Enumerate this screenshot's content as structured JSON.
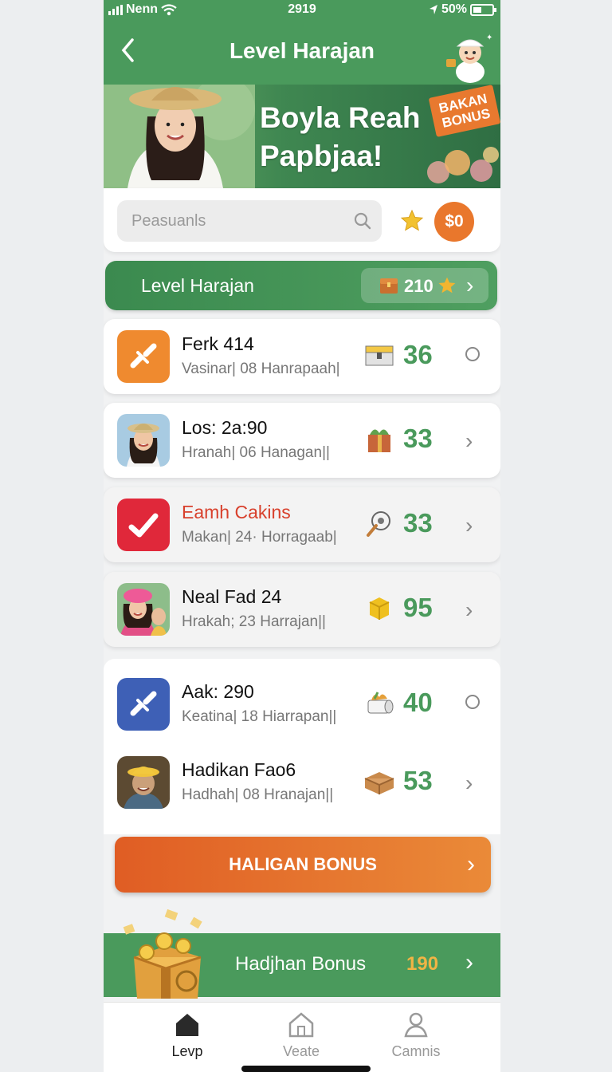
{
  "status_bar": {
    "carrier": "Nenn",
    "time": "2919",
    "battery": "50%"
  },
  "header": {
    "title": "Level Harajan"
  },
  "banner": {
    "headline_line1": "Boyla Reah",
    "headline_line2": "Papbjaa!",
    "tag_line1": "BAKAN",
    "tag_line2": "BONUS"
  },
  "search": {
    "placeholder": "Peasuanls",
    "coin_label": "$0"
  },
  "level_bar": {
    "label": "Level Harajan",
    "value": "210"
  },
  "rows": [
    {
      "name": "Ferk 414",
      "sub": "Vasinar| 08 Hanrapaah|",
      "value": "36",
      "action": "radio",
      "icon": "link-icon",
      "reward_icon": "chest-icon"
    },
    {
      "name": "Los: 2a:90",
      "sub": "Hranah| 06 Hanagan||",
      "value": "33",
      "action": "chevron",
      "icon": "avatar-woman-hat",
      "reward_icon": "gift-icon"
    },
    {
      "name": "Eamh Cakins",
      "sub": "Makan| 24· Horragaab|",
      "value": "33",
      "action": "chevron",
      "icon": "check-icon",
      "reward_icon": "magnifier-icon"
    },
    {
      "name": "Neal Fad 24",
      "sub": "Hrakah; 23 Harrajan||",
      "value": "95",
      "action": "chevron",
      "icon": "avatar-pink-hat",
      "reward_icon": "cube-icon"
    },
    {
      "name": "Aak: 290",
      "sub": "Keatina| 18 Hiarrapan||",
      "value": "40",
      "action": "radio",
      "icon": "link-icon",
      "reward_icon": "scroll-icon"
    },
    {
      "name": "Hadikan Fao6",
      "sub": "Hadhah| 08 Hranajan||",
      "value": "53",
      "action": "chevron",
      "icon": "avatar-man-hat",
      "reward_icon": "box-icon"
    }
  ],
  "bonus_button": {
    "label": "HALIGAN BONUS"
  },
  "bonus_strip": {
    "label": "Hadjhan Bonus",
    "value": "190"
  },
  "tabs": [
    {
      "label": "Levp",
      "active": true
    },
    {
      "label": "Veate",
      "active": false
    },
    {
      "label": "Camnis",
      "active": false
    }
  ],
  "colors": {
    "primary_green": "#4a9a5c",
    "accent_orange": "#e9772c",
    "alert_red": "#d8402c"
  }
}
